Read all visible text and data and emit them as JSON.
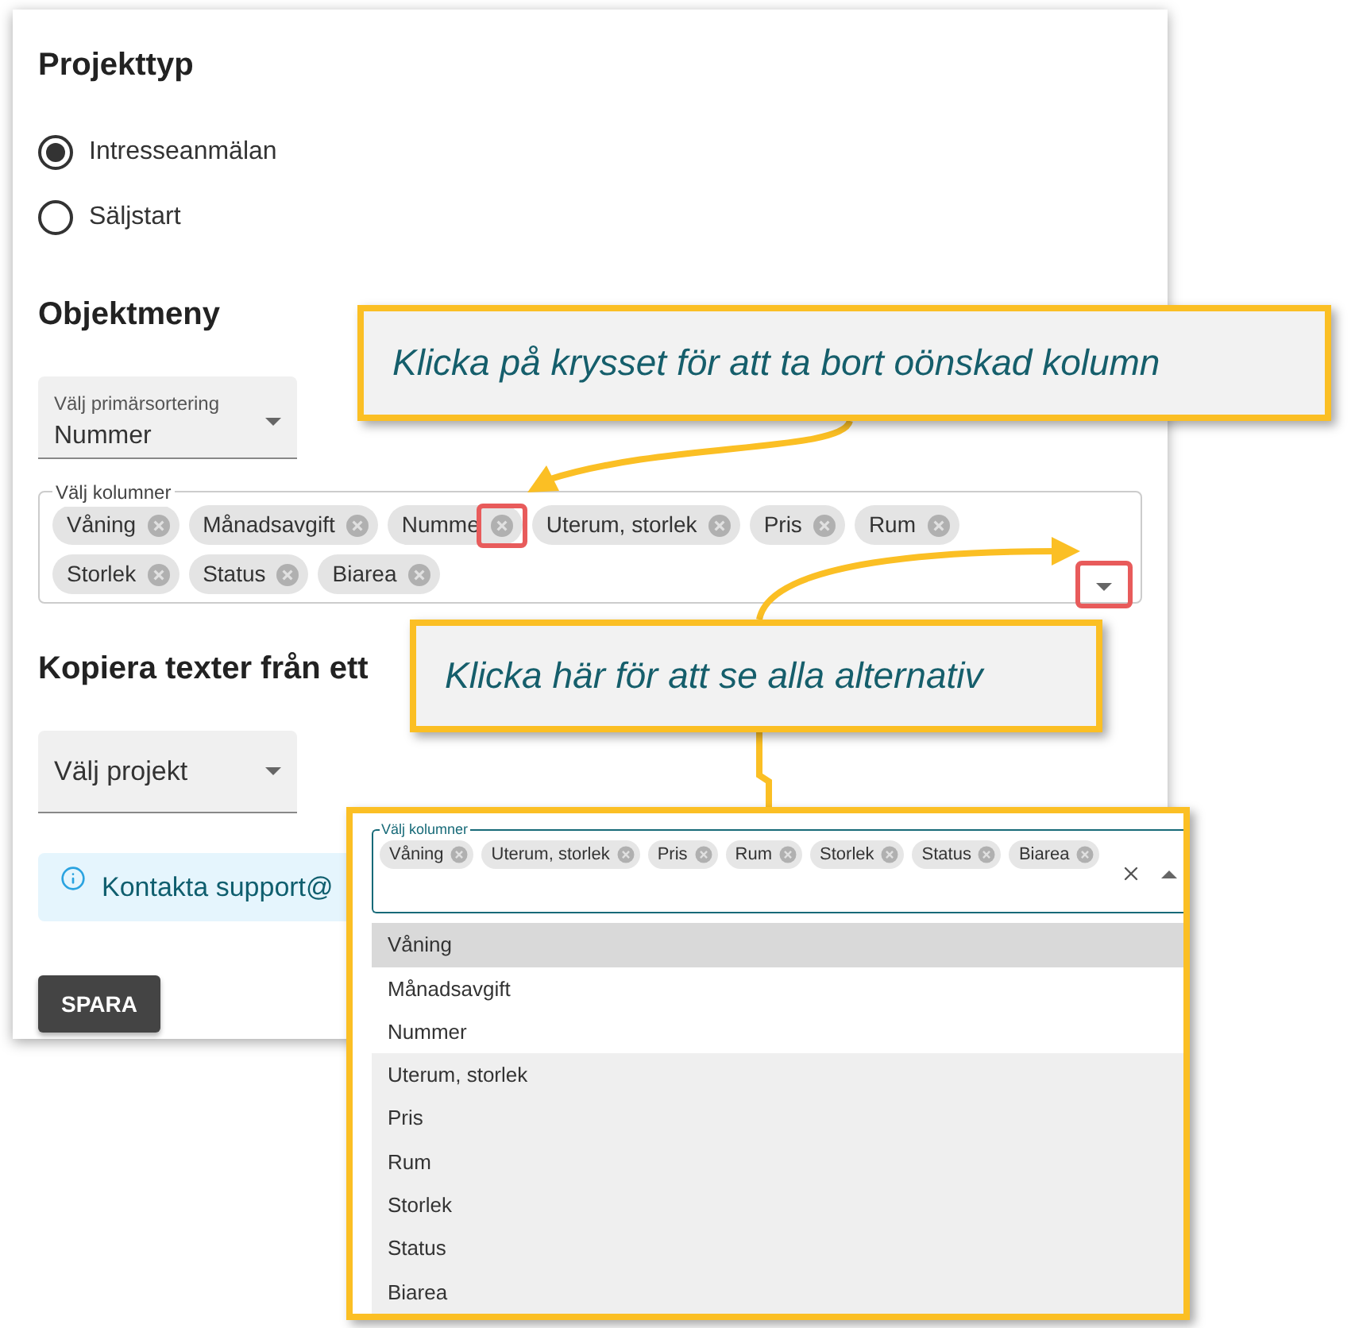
{
  "project_type": {
    "heading": "Projekttyp",
    "options": [
      {
        "label": "Intresseanmälan",
        "selected": true
      },
      {
        "label": "Säljstart",
        "selected": false
      }
    ]
  },
  "object_menu": {
    "heading": "Objektmeny",
    "sort_select": {
      "label": "Välj primärsortering",
      "value": "Nummer"
    },
    "columns_field": {
      "label": "Välj kolumner",
      "chips": [
        "Våning",
        "Månadsavgift",
        "Numme",
        "Uterum, storlek",
        "Pris",
        "Rum",
        "Storlek",
        "Status",
        "Biarea"
      ]
    }
  },
  "copy_texts": {
    "heading": "Kopiera texter från ett",
    "project_select": {
      "value": "Välj projekt"
    }
  },
  "info_alert": {
    "text": "Kontakta support@"
  },
  "save_button": "SPARA",
  "callouts": [
    {
      "text": "Klicka på krysset för att ta bort oönskad kolumn"
    },
    {
      "text": "Klicka här för att se alla alternativ"
    }
  ],
  "dropdown_inset": {
    "label": "Välj kolumner",
    "chips": [
      "Våning",
      "Uterum, storlek",
      "Pris",
      "Rum",
      "Storlek",
      "Status",
      "Biarea"
    ],
    "options": [
      {
        "label": "Våning",
        "selected": true,
        "focused": true
      },
      {
        "label": "Månadsavgift",
        "selected": false,
        "focused": false
      },
      {
        "label": "Nummer",
        "selected": false,
        "focused": false
      },
      {
        "label": "Uterum, storlek",
        "selected": true,
        "focused": false
      },
      {
        "label": "Pris",
        "selected": true,
        "focused": false
      },
      {
        "label": "Rum",
        "selected": true,
        "focused": false
      },
      {
        "label": "Storlek",
        "selected": true,
        "focused": false
      },
      {
        "label": "Status",
        "selected": true,
        "focused": false
      },
      {
        "label": "Biarea",
        "selected": true,
        "focused": false
      }
    ]
  }
}
